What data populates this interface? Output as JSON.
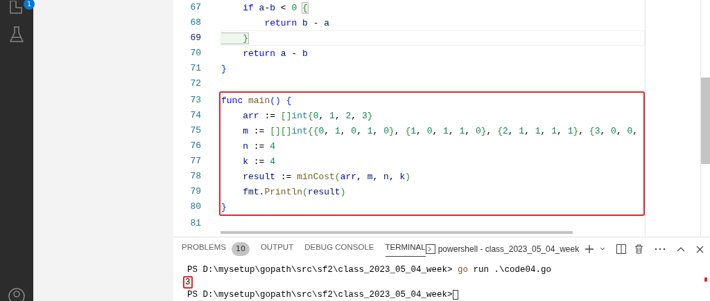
{
  "activity_bar": {
    "badge": "1"
  },
  "editor": {
    "blocks": [
      {
        "highlighted": false,
        "lines": [
          {
            "number": "67",
            "current": false,
            "tokens": [
              {
                "text": "    if ",
                "kind": "kw"
              },
              {
                "text": "a",
                "kind": "id"
              },
              {
                "text": "-",
                "kind": "p"
              },
              {
                "text": "b",
                "kind": "id"
              },
              {
                "text": " < ",
                "kind": "p"
              },
              {
                "text": "0 ",
                "kind": "num"
              },
              {
                "text": "{",
                "kind": "match"
              }
            ]
          },
          {
            "number": "68",
            "current": false,
            "tokens": [
              {
                "text": "        return ",
                "kind": "kw"
              },
              {
                "text": "b",
                "kind": "id"
              },
              {
                "text": " - ",
                "kind": "p"
              },
              {
                "text": "a",
                "kind": "id"
              }
            ]
          },
          {
            "number": "69",
            "current": true,
            "tokens": [
              {
                "text": "    }",
                "kind": "match"
              }
            ]
          },
          {
            "number": "70",
            "current": false,
            "tokens": [
              {
                "text": "    return ",
                "kind": "kw"
              },
              {
                "text": "a",
                "kind": "id"
              },
              {
                "text": " - ",
                "kind": "p"
              },
              {
                "text": "b",
                "kind": "id"
              }
            ]
          },
          {
            "number": "71",
            "current": false,
            "tokens": [
              {
                "text": "}",
                "kind": "br"
              }
            ]
          },
          {
            "number": "72",
            "current": false
          }
        ]
      },
      {
        "highlighted": true,
        "lines": [
          {
            "number": "73",
            "current": false,
            "tokens": [
              {
                "text": "func ",
                "kind": "kw"
              },
              {
                "text": "main",
                "kind": "fn"
              },
              {
                "text": "() {",
                "kind": "br"
              }
            ]
          },
          {
            "number": "74",
            "current": false,
            "tokens": [
              {
                "text": "    arr",
                "kind": "id"
              },
              {
                "text": " := ",
                "kind": "p"
              },
              {
                "text": "[]",
                "kind": "br2"
              },
              {
                "text": "int",
                "kind": "ty"
              },
              {
                "text": "{",
                "kind": "br2"
              },
              {
                "text": "0",
                "kind": "num"
              },
              {
                "text": ", ",
                "kind": "p"
              },
              {
                "text": "1",
                "kind": "num"
              },
              {
                "text": ", ",
                "kind": "p"
              },
              {
                "text": "2",
                "kind": "num"
              },
              {
                "text": ", ",
                "kind": "p"
              },
              {
                "text": "3",
                "kind": "num"
              },
              {
                "text": "}",
                "kind": "br2"
              }
            ]
          },
          {
            "number": "75",
            "current": false,
            "tokens": [
              {
                "text": "    m",
                "kind": "id"
              },
              {
                "text": " := ",
                "kind": "p"
              },
              {
                "text": "[][]",
                "kind": "br2"
              },
              {
                "text": "int",
                "kind": "ty"
              },
              {
                "text": "{{",
                "kind": "br2"
              },
              {
                "text": "0",
                "kind": "num"
              },
              {
                "text": ", ",
                "kind": "p"
              },
              {
                "text": "1",
                "kind": "num"
              },
              {
                "text": ", ",
                "kind": "p"
              },
              {
                "text": "0",
                "kind": "num"
              },
              {
                "text": ", ",
                "kind": "p"
              },
              {
                "text": "1",
                "kind": "num"
              },
              {
                "text": ", ",
                "kind": "p"
              },
              {
                "text": "0",
                "kind": "num"
              },
              {
                "text": "}",
                "kind": "br2"
              },
              {
                "text": ", ",
                "kind": "p"
              },
              {
                "text": "{",
                "kind": "br2"
              },
              {
                "text": "1",
                "kind": "num"
              },
              {
                "text": ", ",
                "kind": "p"
              },
              {
                "text": "0",
                "kind": "num"
              },
              {
                "text": ", ",
                "kind": "p"
              },
              {
                "text": "1",
                "kind": "num"
              },
              {
                "text": ", ",
                "kind": "p"
              },
              {
                "text": "1",
                "kind": "num"
              },
              {
                "text": ", ",
                "kind": "p"
              },
              {
                "text": "0",
                "kind": "num"
              },
              {
                "text": "}",
                "kind": "br2"
              },
              {
                "text": ", ",
                "kind": "p"
              },
              {
                "text": "{",
                "kind": "br2"
              },
              {
                "text": "2",
                "kind": "num"
              },
              {
                "text": ", ",
                "kind": "p"
              },
              {
                "text": "1",
                "kind": "num"
              },
              {
                "text": ", ",
                "kind": "p"
              },
              {
                "text": "1",
                "kind": "num"
              },
              {
                "text": ", ",
                "kind": "p"
              },
              {
                "text": "1",
                "kind": "num"
              },
              {
                "text": ", ",
                "kind": "p"
              },
              {
                "text": "1",
                "kind": "num"
              },
              {
                "text": "}",
                "kind": "br2"
              },
              {
                "text": ", ",
                "kind": "p"
              },
              {
                "text": "{",
                "kind": "br2"
              },
              {
                "text": "3",
                "kind": "num"
              },
              {
                "text": ", ",
                "kind": "p"
              },
              {
                "text": "0",
                "kind": "num"
              },
              {
                "text": ", ",
                "kind": "p"
              },
              {
                "text": "0",
                "kind": "num"
              },
              {
                "text": ",",
                "kind": "p"
              }
            ]
          },
          {
            "number": "76",
            "current": false,
            "tokens": [
              {
                "text": "    n",
                "kind": "id"
              },
              {
                "text": " := ",
                "kind": "p"
              },
              {
                "text": "4",
                "kind": "num"
              }
            ]
          },
          {
            "number": "77",
            "current": false,
            "tokens": [
              {
                "text": "    k",
                "kind": "id"
              },
              {
                "text": " := ",
                "kind": "p"
              },
              {
                "text": "4",
                "kind": "num"
              }
            ]
          },
          {
            "number": "78",
            "current": false,
            "tokens": [
              {
                "text": "    result",
                "kind": "id"
              },
              {
                "text": " := ",
                "kind": "p"
              },
              {
                "text": "minCost",
                "kind": "fn"
              },
              {
                "text": "(",
                "kind": "br2"
              },
              {
                "text": "arr",
                "kind": "id"
              },
              {
                "text": ", ",
                "kind": "p"
              },
              {
                "text": "m",
                "kind": "id"
              },
              {
                "text": ", ",
                "kind": "p"
              },
              {
                "text": "n",
                "kind": "id"
              },
              {
                "text": ", ",
                "kind": "p"
              },
              {
                "text": "k",
                "kind": "id"
              },
              {
                "text": ")",
                "kind": "br2"
              }
            ]
          },
          {
            "number": "79",
            "current": false,
            "tokens": [
              {
                "text": "    fmt",
                "kind": "id"
              },
              {
                "text": ".",
                "kind": "p"
              },
              {
                "text": "Println",
                "kind": "fn"
              },
              {
                "text": "(",
                "kind": "br2"
              },
              {
                "text": "result",
                "kind": "id"
              },
              {
                "text": ")",
                "kind": "br2"
              }
            ]
          },
          {
            "number": "80",
            "current": false,
            "tokens": [
              {
                "text": "}",
                "kind": "br"
              }
            ]
          }
        ]
      },
      {
        "highlighted": false,
        "lines": [
          {
            "number": "81",
            "current": false
          }
        ]
      }
    ]
  },
  "panel": {
    "tabs": [
      {
        "label": "PROBLEMS",
        "selected": false,
        "count": "10"
      },
      {
        "label": "OUTPUT",
        "selected": false
      },
      {
        "label": "DEBUG CONSOLE",
        "selected": false
      },
      {
        "label": "TERMINAL",
        "selected": true
      }
    ],
    "terminal_selector": "powershell - class_2023_05_04_week",
    "terminal_lines": [
      {
        "highlighted": false,
        "cursor": false,
        "tokens": [
          {
            "text": "PS D:\\mysetup\\gopath\\src\\sf2\\class_2023_05_04_week> ",
            "kind": "p"
          },
          {
            "text": "go",
            "kind": "cmd"
          },
          {
            "text": " run .\\code04.go",
            "kind": "p"
          }
        ]
      },
      {
        "highlighted": true,
        "cursor": false,
        "tokens": [
          {
            "text": "3",
            "kind": "p"
          }
        ]
      },
      {
        "highlighted": false,
        "cursor": true,
        "tokens": [
          {
            "text": "PS D:\\mysetup\\gopath\\src\\sf2\\class_2023_05_04_week>",
            "kind": "p"
          }
        ]
      }
    ]
  }
}
